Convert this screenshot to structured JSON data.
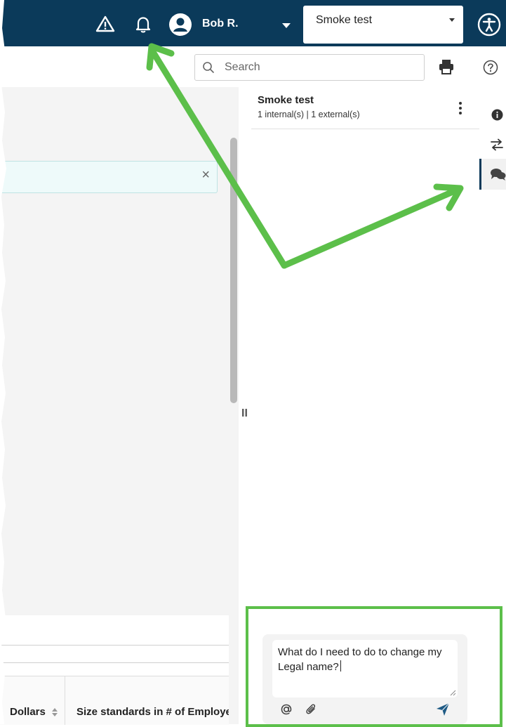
{
  "topbar": {
    "icons": [
      "warning-icon",
      "bell-icon",
      "user-avatar-icon",
      "accessibility-icon"
    ],
    "user_name": "Bob R.",
    "context_select": {
      "value": "Smoke test"
    }
  },
  "toolbar": {
    "search_placeholder": "Search",
    "icons": [
      "search-icon",
      "print-icon",
      "help-icon"
    ]
  },
  "banner": {
    "close_icon": "close-icon",
    "close_glyph": "×"
  },
  "splitter": {
    "grip_glyph": "II"
  },
  "table": {
    "columns": [
      {
        "label": "Dollars",
        "sortable": true
      },
      {
        "label": "Size standards in # of Employees",
        "sortable": false
      }
    ]
  },
  "panel": {
    "title": "Smoke test",
    "subtitle": "1 internal(s) | 1 external(s)",
    "composer": {
      "value": "What do I need to do to change my Legal name?",
      "icons": [
        "mention-icon",
        "attachment-icon",
        "send-icon"
      ]
    }
  },
  "rail": {
    "items": [
      {
        "icon": "info-icon",
        "active": false
      },
      {
        "icon": "transfer-icon",
        "active": false
      },
      {
        "icon": "chat-icon",
        "active": true
      }
    ]
  },
  "annotations": {
    "color": "#5cbf4a",
    "arrows": [
      "arrow-to-notifications",
      "arrow-to-chat-rail"
    ],
    "highlight": "composer-highlight-box"
  },
  "colors": {
    "nav": "#0b3a5a",
    "accent": "#1f5b85",
    "annotation": "#5cbf4a"
  }
}
